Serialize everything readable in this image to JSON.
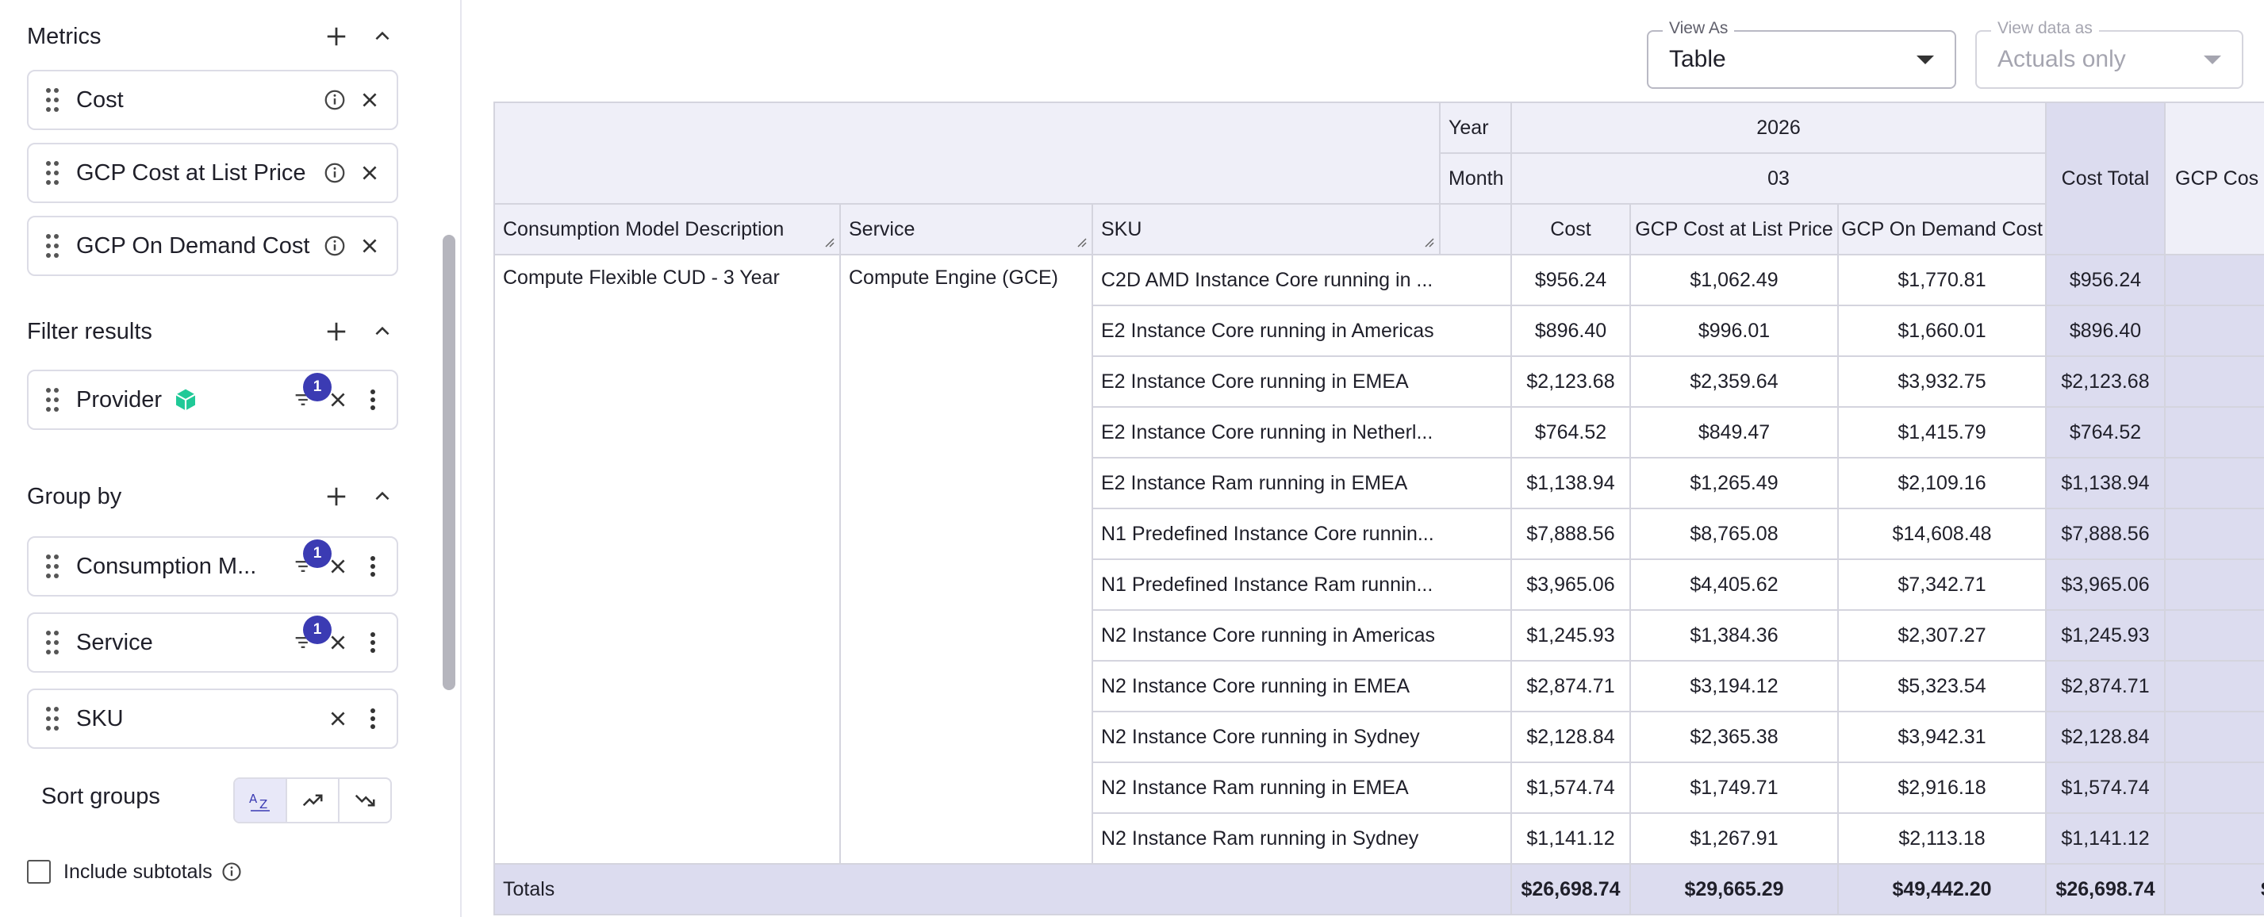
{
  "sidebar": {
    "metrics": {
      "title": "Metrics",
      "items": [
        {
          "label": "Cost"
        },
        {
          "label": "GCP Cost at List Price"
        },
        {
          "label": "GCP On Demand Cost"
        }
      ]
    },
    "filter": {
      "title": "Filter results",
      "items": [
        {
          "label": "Provider",
          "badge": "1"
        }
      ]
    },
    "groupby": {
      "title": "Group by",
      "items": [
        {
          "label": "Consumption M...",
          "badge": "1"
        },
        {
          "label": "Service",
          "badge": "1"
        },
        {
          "label": "SKU"
        }
      ]
    },
    "sort": {
      "label": "Sort groups",
      "options": [
        "A-Z",
        "ascending",
        "descending"
      ],
      "selected": "A-Z"
    },
    "subtotals": {
      "label": "Include subtotals",
      "checked": false
    },
    "accent_color": "#3b3bb3"
  },
  "view_as": {
    "legend": "View As",
    "value": "Table"
  },
  "view_data": {
    "legend": "View data as",
    "value": "Actuals only"
  },
  "table": {
    "year_label": "Year",
    "year_value": "2026",
    "month_label": "Month",
    "month_value": "03",
    "cost_total_label": "Cost Total",
    "gcp_cost_total_label": "GCP Cos",
    "row_headers": [
      "Consumption Model Description",
      "Service",
      "SKU"
    ],
    "metric_headers": [
      "Cost",
      "GCP Cost at List Price",
      "GCP On Demand Cost"
    ],
    "consumption_model": "Compute Flexible CUD - 3 Year",
    "service": "Compute Engine (GCE)",
    "rows": [
      {
        "sku": "C2D AMD Instance Core running in ...",
        "cost": "$956.24",
        "list": "$1,062.49",
        "ondemand": "$1,770.81",
        "total": "$956.24"
      },
      {
        "sku": "E2 Instance Core running in Americas",
        "cost": "$896.40",
        "list": "$996.01",
        "ondemand": "$1,660.01",
        "total": "$896.40"
      },
      {
        "sku": "E2 Instance Core running in EMEA",
        "cost": "$2,123.68",
        "list": "$2,359.64",
        "ondemand": "$3,932.75",
        "total": "$2,123.68"
      },
      {
        "sku": "E2 Instance Core running in Netherl...",
        "cost": "$764.52",
        "list": "$849.47",
        "ondemand": "$1,415.79",
        "total": "$764.52"
      },
      {
        "sku": "E2 Instance Ram running in EMEA",
        "cost": "$1,138.94",
        "list": "$1,265.49",
        "ondemand": "$2,109.16",
        "total": "$1,138.94"
      },
      {
        "sku": "N1 Predefined Instance Core runnin...",
        "cost": "$7,888.56",
        "list": "$8,765.08",
        "ondemand": "$14,608.48",
        "total": "$7,888.56"
      },
      {
        "sku": "N1 Predefined Instance Ram runnin...",
        "cost": "$3,965.06",
        "list": "$4,405.62",
        "ondemand": "$7,342.71",
        "total": "$3,965.06"
      },
      {
        "sku": "N2 Instance Core running in Americas",
        "cost": "$1,245.93",
        "list": "$1,384.36",
        "ondemand": "$2,307.27",
        "total": "$1,245.93"
      },
      {
        "sku": "N2 Instance Core running in EMEA",
        "cost": "$2,874.71",
        "list": "$3,194.12",
        "ondemand": "$5,323.54",
        "total": "$2,874.71"
      },
      {
        "sku": "N2 Instance Core running in Sydney",
        "cost": "$2,128.84",
        "list": "$2,365.38",
        "ondemand": "$3,942.31",
        "total": "$2,128.84"
      },
      {
        "sku": "N2 Instance Ram running in EMEA",
        "cost": "$1,574.74",
        "list": "$1,749.71",
        "ondemand": "$2,916.18",
        "total": "$1,574.74"
      },
      {
        "sku": "N2 Instance Ram running in Sydney",
        "cost": "$1,141.12",
        "list": "$1,267.91",
        "ondemand": "$2,113.18",
        "total": "$1,141.12"
      }
    ],
    "totals": {
      "label": "Totals",
      "cost": "$26,698.74",
      "list": "$29,665.29",
      "ondemand": "$49,442.20",
      "total": "$26,698.74",
      "next_partial": "$"
    }
  }
}
